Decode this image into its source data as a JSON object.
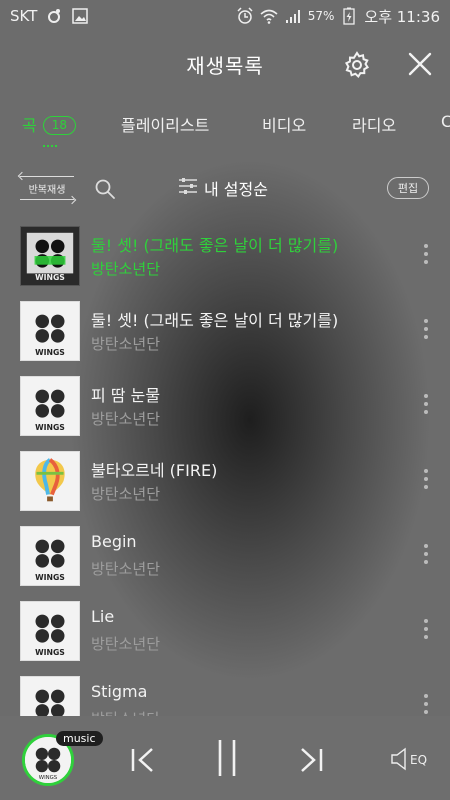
{
  "status": {
    "carrier": "SKT",
    "battery_pct": "57%",
    "clock": "오후 11:36"
  },
  "header": {
    "title": "재생목록"
  },
  "tabs": [
    {
      "label": "곡",
      "count": "18",
      "active": true
    },
    {
      "label": "플레이리스트"
    },
    {
      "label": "비디오"
    },
    {
      "label": "라디오"
    },
    {
      "label": "C"
    }
  ],
  "controls": {
    "repeat_label": "반복재생",
    "sort_label": "내 설정순",
    "edit_label": "편집"
  },
  "songs": [
    {
      "title": "둘! 셋! (그래도 좋은 날이 더 많기를)",
      "artist": "방탄소년단",
      "playing": true,
      "cover": "wings-dark"
    },
    {
      "title": "둘! 셋! (그래도 좋은 날이 더 많기를)",
      "artist": "방탄소년단",
      "cover": "wings"
    },
    {
      "title": "피 땀 눈물",
      "artist": "방탄소년단",
      "cover": "wings"
    },
    {
      "title": "불타오르네 (FIRE)",
      "artist": "방탄소년단",
      "cover": "balloon"
    },
    {
      "title": "Begin",
      "artist": "방탄소년단",
      "cover": "wings"
    },
    {
      "title": "Lie",
      "artist": "방탄소년단",
      "cover": "wings"
    },
    {
      "title": "Stigma",
      "artist": "방탄소년단",
      "cover": "wings"
    }
  ],
  "player": {
    "badge": "music",
    "eq_label": "EQ"
  },
  "album_text": "WINGS",
  "colors": {
    "accent": "#2fd13b"
  }
}
